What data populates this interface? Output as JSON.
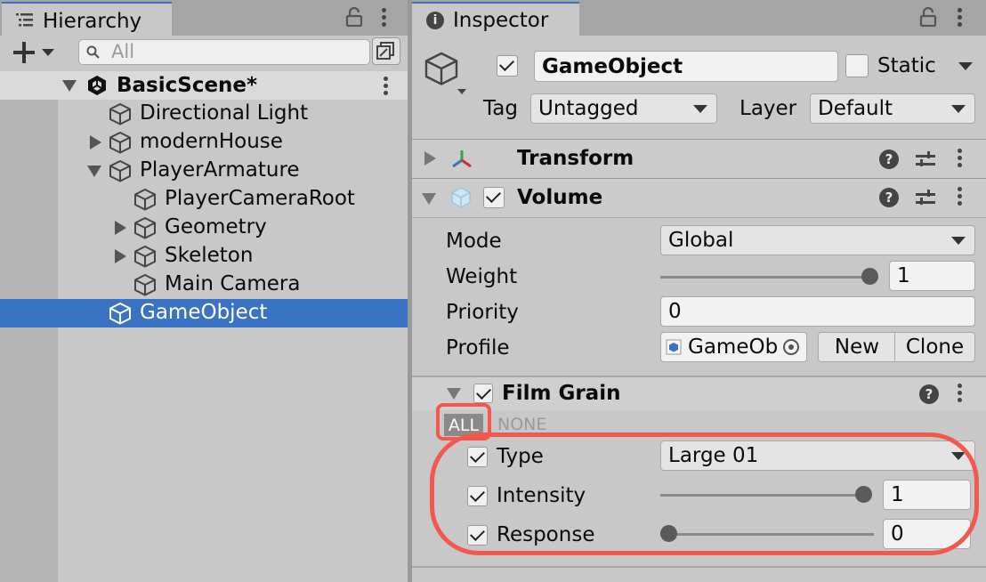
{
  "hierarchy": {
    "tab_label": "Hierarchy",
    "search_placeholder": "All",
    "scene_name": "BasicScene*",
    "items": [
      {
        "label": "Directional Light"
      },
      {
        "label": "modernHouse"
      },
      {
        "label": "PlayerArmature"
      },
      {
        "label": "PlayerCameraRoot"
      },
      {
        "label": "Geometry"
      },
      {
        "label": "Skeleton"
      },
      {
        "label": "Main Camera"
      },
      {
        "label": "GameObject"
      }
    ]
  },
  "inspector": {
    "tab_label": "Inspector",
    "object_name": "GameObject",
    "static_label": "Static",
    "tag_label": "Tag",
    "tag_value": "Untagged",
    "layer_label": "Layer",
    "layer_value": "Default",
    "components": {
      "transform_title": "Transform",
      "volume_title": "Volume"
    },
    "volume": {
      "mode_label": "Mode",
      "mode_value": "Global",
      "weight_label": "Weight",
      "weight_value": "1",
      "weight_fraction": 1.0,
      "priority_label": "Priority",
      "priority_value": "0",
      "profile_label": "Profile",
      "profile_value": "GameOb",
      "new_label": "New",
      "clone_label": "Clone"
    },
    "film_grain": {
      "title": "Film Grain",
      "all_label": "ALL",
      "none_label": "NONE",
      "type_label": "Type",
      "type_value": "Large 01",
      "intensity_label": "Intensity",
      "intensity_value": "1",
      "intensity_fraction": 1.0,
      "response_label": "Response",
      "response_value": "0",
      "response_fraction": 0.0
    }
  },
  "colors": {
    "selection": "#3a72c4",
    "highlight": "#f2584d",
    "panel_bg": "#c8c8c8"
  }
}
